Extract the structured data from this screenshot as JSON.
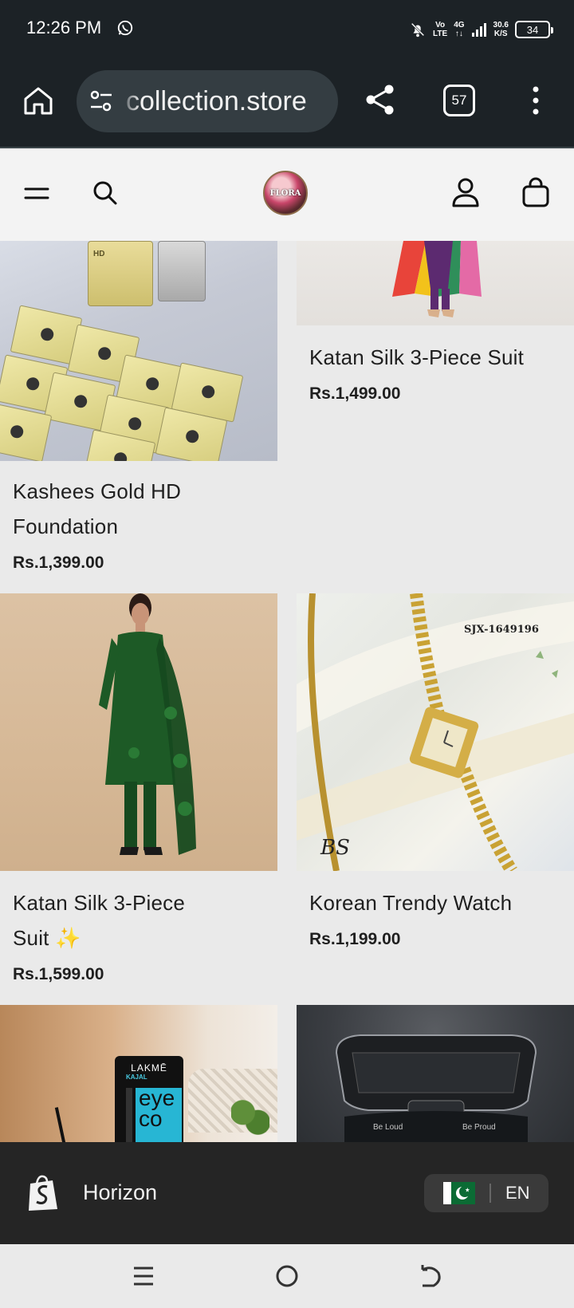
{
  "status_bar": {
    "time": "12:26 PM",
    "net_type_top": "Vo",
    "net_type_bottom": "LTE",
    "signal_label_top": "4G",
    "speed_top": "30.6",
    "speed_bottom": "K/S",
    "battery": "34"
  },
  "browser": {
    "url": "collection.store",
    "tab_count": "57"
  },
  "store": {
    "logo_text": "FLORA"
  },
  "products": [
    {
      "name": "Kashees Gold HD Foundation",
      "name_line1": "Kashees Gold HD",
      "name_line2": "Foundation",
      "price": "Rs.1,399.00",
      "image_icon": "foundation-image"
    },
    {
      "name": "Katan Silk 3-Piece Suit",
      "price": "Rs.1,499.00",
      "image_icon": "colorful-suit-image"
    },
    {
      "name": "Katan Silk 3-Piece Suit ✨",
      "name_line1": "Katan Silk 3-Piece",
      "name_line2": "Suit ✨",
      "price": "Rs.1,599.00",
      "image_icon": "green-suit-image"
    },
    {
      "name": "Korean Trendy Watch",
      "price": "Rs.1,199.00",
      "image_icon": "gold-watch-image",
      "image_text": "SJX-1649196",
      "image_mark": "BS"
    },
    {
      "name": "",
      "price": "",
      "image_icon": "kajal-image",
      "image_brand": "LAKMĒ",
      "image_subtitle": "KAJAL",
      "image_word1": "eye",
      "image_word2": "co"
    },
    {
      "name": "",
      "price": "",
      "image_icon": "earbuds-case-image",
      "image_left": "Be Loud",
      "image_right": "Be Proud"
    }
  ],
  "footer": {
    "store_name": "Horizon",
    "language": "EN"
  },
  "colors": {
    "chrome": "#1c2226",
    "page_bg": "#eaeaea",
    "footer_bg": "#252525"
  }
}
